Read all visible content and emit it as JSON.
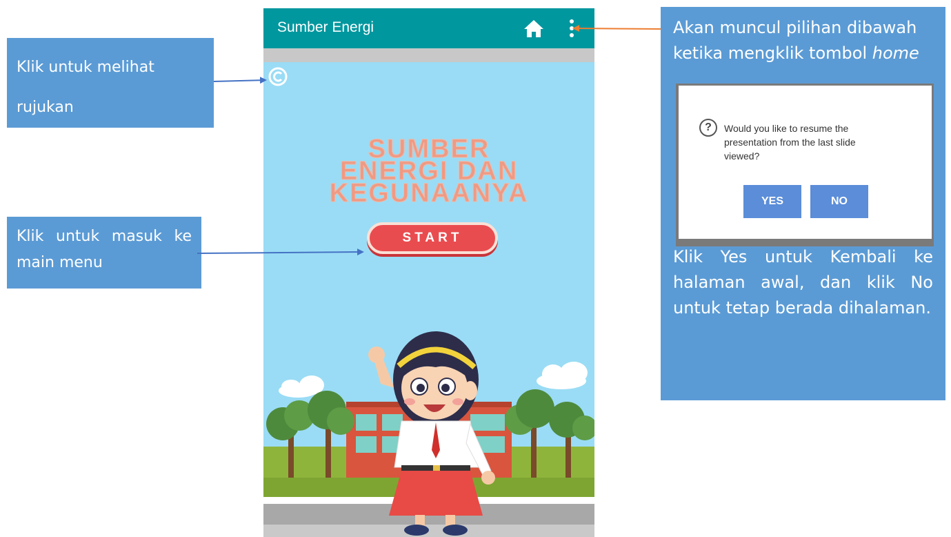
{
  "app": {
    "title": "Sumber Energi",
    "home_icon": "home-icon",
    "more_icon": "more-vertical-icon",
    "copyright_icon": "copyright-icon"
  },
  "main": {
    "title_lines": [
      "SUMBER",
      "ENERGI DAN",
      "KEGUNAANYA"
    ],
    "start_label": "START"
  },
  "annotations": {
    "references": "Klik untuk melihat rujukan",
    "start": "Klik untuk masuk ke main menu",
    "home_intro": "Akan muncul pilihan dibawah ketika mengklik tombol",
    "home_word": "home",
    "home_outro": "Klik Yes untuk Kembali ke halaman awal, dan klik No untuk tetap berada dihalaman."
  },
  "dialog": {
    "icon": "question-icon",
    "message": "Would you like to resume the presentation from the last slide viewed?",
    "yes_label": "YES",
    "no_label": "NO"
  },
  "colors": {
    "appbar": "#01979f",
    "sky": "#9adcf5",
    "note": "#5b9bd5",
    "title": "#ef9a84",
    "start": "#e94c4f",
    "dialog_button": "#5b8dd9",
    "arrow_blue": "#4472c4",
    "arrow_orange": "#ed7d31"
  }
}
